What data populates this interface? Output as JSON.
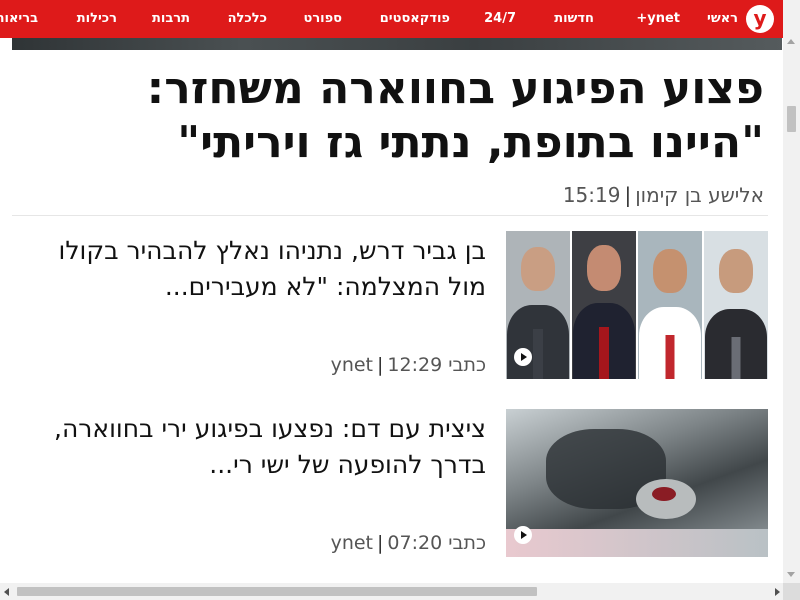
{
  "nav": {
    "logo": "y",
    "items": [
      {
        "label": "ראשי"
      },
      {
        "label": "ynet+"
      },
      {
        "label": "חדשות"
      },
      {
        "label": "24/7"
      },
      {
        "label": "פודקאסטים"
      },
      {
        "label": "ספורט"
      },
      {
        "label": "כלכלה"
      },
      {
        "label": "תרבות"
      },
      {
        "label": "רכילות"
      },
      {
        "label": "בריאות"
      }
    ]
  },
  "article": {
    "headline": "פצוע הפיגוע בחווארה משחזר: \"היינו בתופת, נתתי גז ויריתי\"",
    "author": "אלישע בן קימון",
    "time": "15:19"
  },
  "cards": [
    {
      "title": "בן גביר דרש, נתניהו נאלץ להבהיר בקולו מול המצלמה: \"לא מעבירים...",
      "source": "כתבי ynet",
      "time": "12:29"
    },
    {
      "title": "ציצית עם דם: נפצעו בפיגוע ירי בחווארה, בדרך להופעה של ישי רי...",
      "source": "כתבי ynet",
      "time": "07:20"
    }
  ],
  "colors": {
    "brand_red": "#de1a1a",
    "text": "#111111",
    "meta": "#555555"
  },
  "icons": {
    "logo": "ynet-logo",
    "play": "play-icon"
  }
}
